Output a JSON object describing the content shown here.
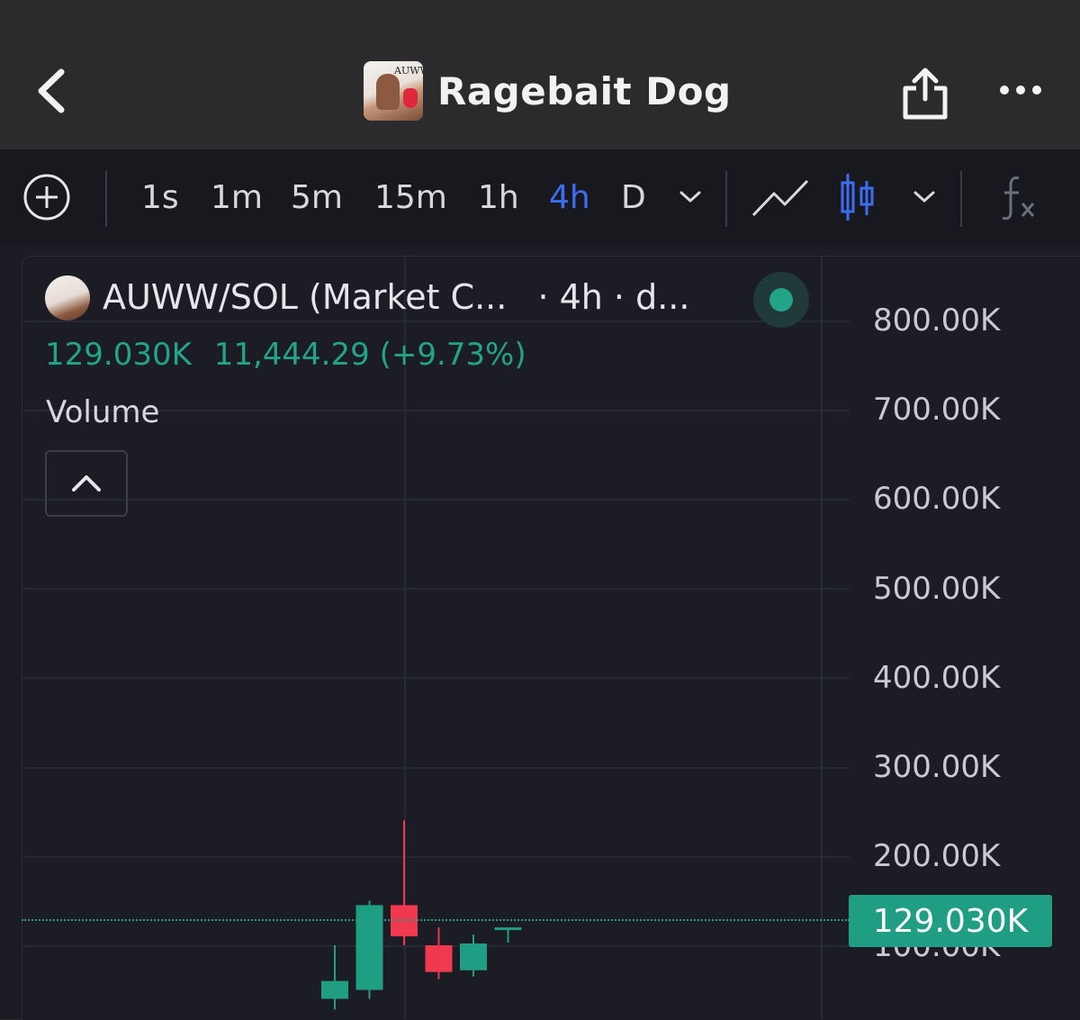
{
  "header": {
    "title": "Ragebait Dog",
    "avatar_text": "AUWW"
  },
  "toolbar": {
    "timeframes": [
      "1s",
      "1m",
      "5m",
      "15m",
      "1h",
      "4h",
      "D"
    ],
    "active_timeframe": "4h"
  },
  "legend": {
    "symbol_title": "AUWW/SOL (Market C...",
    "interval_text": "· 4h · d...",
    "last_value": "129.030K",
    "change": "11,444.29 (+9.73%)",
    "indicator": "Volume"
  },
  "y_axis": {
    "ticks": [
      "800.00K",
      "700.00K",
      "600.00K",
      "500.00K",
      "400.00K",
      "300.00K",
      "200.00K",
      "100.00K"
    ]
  },
  "price_badge": "129.030K",
  "colors": {
    "up": "#1f9e83",
    "down": "#f0384e",
    "accent": "#3d6df5"
  },
  "chart_data": {
    "type": "candlestick",
    "interval": "4h",
    "ylim": [
      0,
      850000
    ],
    "last_price": 129030,
    "candles": [
      {
        "open": 40000,
        "high": 100000,
        "low": 28000,
        "close": 60000
      },
      {
        "open": 50000,
        "high": 150000,
        "low": 40000,
        "close": 145000
      },
      {
        "open": 145000,
        "high": 240000,
        "low": 100000,
        "close": 110000
      },
      {
        "open": 100000,
        "high": 120000,
        "low": 62000,
        "close": 70000
      },
      {
        "open": 72000,
        "high": 112000,
        "low": 65000,
        "close": 102000
      },
      {
        "open": 120000,
        "high": 120000,
        "low": 103000,
        "close": 120000
      }
    ]
  }
}
